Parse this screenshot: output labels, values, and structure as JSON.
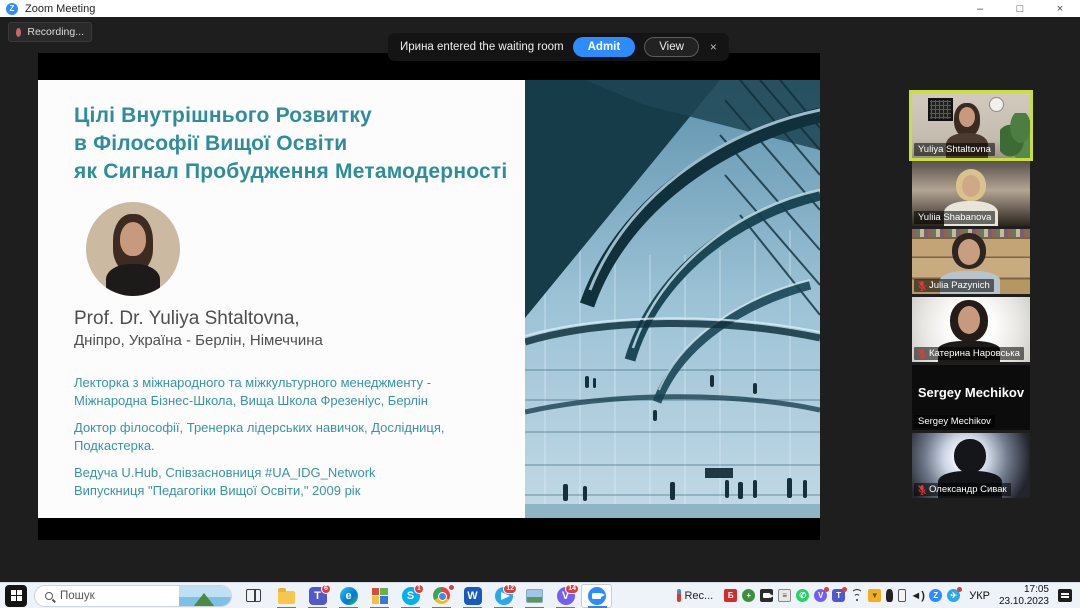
{
  "window": {
    "title": "Zoom Meeting",
    "minimize": "–",
    "maximize": "□",
    "close": "×"
  },
  "recording": {
    "label": "Recording..."
  },
  "notification": {
    "message": "Ирина entered the waiting room",
    "admit_label": "Admit",
    "view_label": "View",
    "close_label": "×"
  },
  "slide": {
    "title_lines": [
      "Цілі Внутрішнього Розвитку",
      "в Філософії Вищої Освіти",
      "як Сигнал Пробудження Метамодерності"
    ],
    "name": "Prof. Dr. Yuliya Shtaltovna,",
    "location": "Дніпро, Україна - Берлін, Німеччина",
    "bio": [
      [
        "Лекторка з міжнародного та міжкультурного менеджменту -",
        "Міжнародна Бізнес-Школа, Вища Школа Фрезеніус, Берлін"
      ],
      [
        "Доктор філософії, Тренерка лідерських навичок, Дослідниця,",
        "Подкастерка."
      ],
      [
        "Ведуча U.Hub, Співзасновниця #UA_IDG_Network",
        "Випускниця \"Педагогіки Вищої Освіти,\" 2009 рік"
      ]
    ],
    "photo_description": "Reichstag dome interior, blue tones"
  },
  "participants": [
    {
      "name": "Yuliya Shtaltovna",
      "muted": false,
      "active": true
    },
    {
      "name": "Yuliia Shabanova",
      "muted": false
    },
    {
      "name": "Julia Pazynich",
      "muted": true
    },
    {
      "name": "Катерина Наровська",
      "muted": true
    },
    {
      "name": "Sergey Mechikov",
      "muted": false,
      "video_off": true
    },
    {
      "name": "Олександр Сивак",
      "muted": true
    }
  ],
  "colors": {
    "accent_blue": "#2d8cff",
    "slide_teal": "#2e8d9a",
    "active_border": "#c9df3f",
    "muted_mic_red": "#e23b3b",
    "taskbar_bg": "#eef3f9"
  },
  "taskbar": {
    "search_placeholder": "Пошук",
    "apps": [
      {
        "name": "file-explorer",
        "badge": ""
      },
      {
        "name": "teams",
        "badge": "6"
      },
      {
        "name": "edge",
        "badge": ""
      },
      {
        "name": "app-mosaic",
        "badge": ""
      },
      {
        "name": "skype",
        "badge": "1"
      },
      {
        "name": "chrome",
        "badge": ""
      },
      {
        "name": "word",
        "badge": ""
      },
      {
        "name": "telegram",
        "badge": "12"
      },
      {
        "name": "photos",
        "badge": ""
      },
      {
        "name": "viber",
        "badge": "14"
      },
      {
        "name": "zoom",
        "badge": "",
        "active": true
      }
    ],
    "tray": {
      "rec_label": "Rec...",
      "icons": [
        "red-app-icon",
        "security-shield-icon",
        "camera-icon",
        "clipboard-icon",
        "whatsapp-icon",
        "viber-tray-icon",
        "teams-tray-icon",
        "wifi-icon",
        "download-funnel-icon",
        "microphone-icon",
        "phone-icon",
        "volume-icon",
        "zoom-tray-icon",
        "telegram-tray-icon"
      ],
      "language": "УКР",
      "time": "17:05",
      "date": "23.10.2023"
    }
  }
}
